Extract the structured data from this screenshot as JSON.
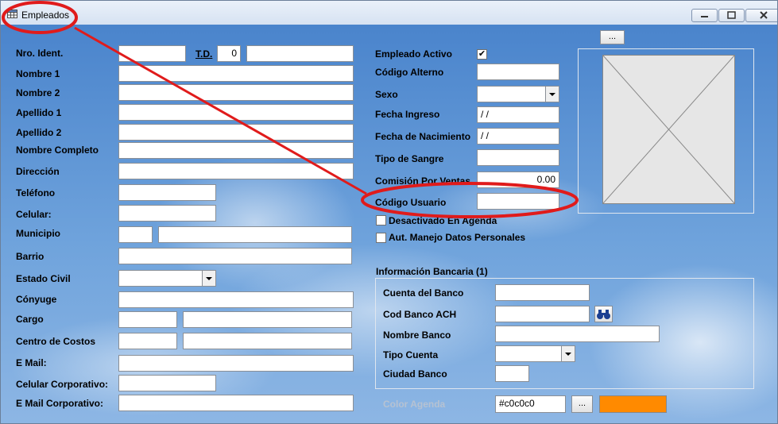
{
  "window": {
    "title": "Empleados",
    "photo_button": "...",
    "color_button": "..."
  },
  "form_left": {
    "nro_ident": {
      "label": "Nro. Ident.",
      "value": ""
    },
    "td": {
      "label": "T.D.",
      "value": "0"
    },
    "nombre1": "Nombre 1",
    "nombre2": "Nombre 2",
    "apellido1": "Apellido 1",
    "apellido2": "Apellido 2",
    "nombre_completo": "Nombre Completo",
    "direccion": "Dirección",
    "telefono": "Teléfono",
    "celular": "Celular:",
    "municipio": "Municipio",
    "barrio": "Barrio",
    "estado_civil": "Estado Civil",
    "conyuge": "Cónyuge",
    "cargo": "Cargo",
    "centro_costos": "Centro de Costos",
    "email": "E Mail:",
    "celular_corp": "Celular Corporativo:",
    "email_corp": "E Mail Corporativo:"
  },
  "form_right": {
    "empleado_activo": {
      "label": "Empleado Activo",
      "checked": "✔"
    },
    "codigo_alterno": "Código Alterno",
    "sexo": "Sexo",
    "fecha_ingreso": {
      "label": "Fecha Ingreso",
      "value": " / /"
    },
    "fecha_nacimiento": {
      "label": "Fecha de Nacimiento",
      "value": " / /"
    },
    "tipo_sangre": "Tipo de Sangre",
    "comision": {
      "label": "Comisión Por Ventas",
      "value": "0.00"
    },
    "codigo_usuario": "Código Usuario",
    "desactivado_agenda": "Desactivado En Agenda",
    "aut_datos": "Aut. Manejo Datos Personales"
  },
  "bank": {
    "title": "Información Bancaria (1)",
    "cuenta": "Cuenta del Banco",
    "cod_ach": "Cod Banco ACH",
    "nombre": "Nombre Banco",
    "tipo_cuenta": "Tipo Cuenta",
    "ciudad": "Ciudad Banco"
  },
  "agenda": {
    "label": "Color Agenda",
    "value": "#c0c0c0",
    "swatch_color": "#ff8a00"
  },
  "colors": {
    "annotation": "#e01b1b"
  }
}
